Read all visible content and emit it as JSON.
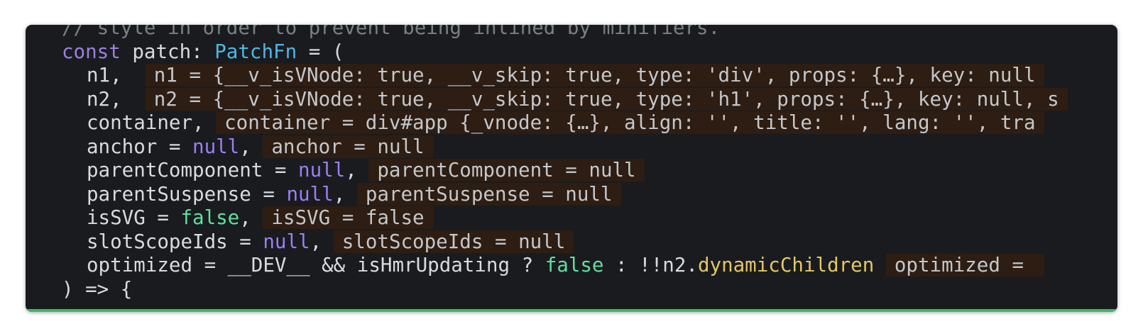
{
  "editor": {
    "colors": {
      "background": "#1a1b1e",
      "keyword": "#9d7fe0",
      "type": "#4fb6e6",
      "null": "#9b7ff2",
      "false": "#5ee0a1",
      "property": "#e2c766",
      "inlay_bg": "#2d1d12",
      "status_bar": "#3bb86a"
    },
    "line0": {
      "comment": "// style in order to prevent being inlined by minifiers."
    },
    "line1": {
      "kw": "const",
      "name": " patch: ",
      "type": "PatchFn",
      "rest": " = ("
    },
    "line2": {
      "code": "n1, ",
      "hint": "n1 = {__v_isVNode: true, __v_skip: true, type: 'div', props: {…}, key: null"
    },
    "line3": {
      "code": "n2, ",
      "hint": "n2 = {__v_isVNode: true, __v_skip: true, type: 'h1', props: {…}, key: null, s"
    },
    "line4": {
      "code": "container, ",
      "hint": "container = div#app {_vnode: {…}, align: '', title: '', lang: '', tra"
    },
    "line5": {
      "code": "anchor = ",
      "val": "null",
      "comma": ", ",
      "hint": "anchor = null"
    },
    "line6": {
      "code": "parentComponent = ",
      "val": "null",
      "comma": ", ",
      "hint": "parentComponent = null"
    },
    "line7": {
      "code": "parentSuspense = ",
      "val": "null",
      "comma": ", ",
      "hint": "parentSuspense = null"
    },
    "line8": {
      "code": "isSVG = ",
      "val": "false",
      "comma": ", ",
      "hint": "isSVG = false"
    },
    "line9": {
      "code": "slotScopeIds = ",
      "val": "null",
      "comma": ", ",
      "hint": "slotScopeIds = null"
    },
    "line10": {
      "code": "optimized = __DEV__ && isHmrUpdating ? ",
      "val": "false",
      "mid": " : !!n2.",
      "prop": "dynamicChildren",
      "hint": "optimized = "
    },
    "line11": {
      "code": ") => {"
    }
  }
}
